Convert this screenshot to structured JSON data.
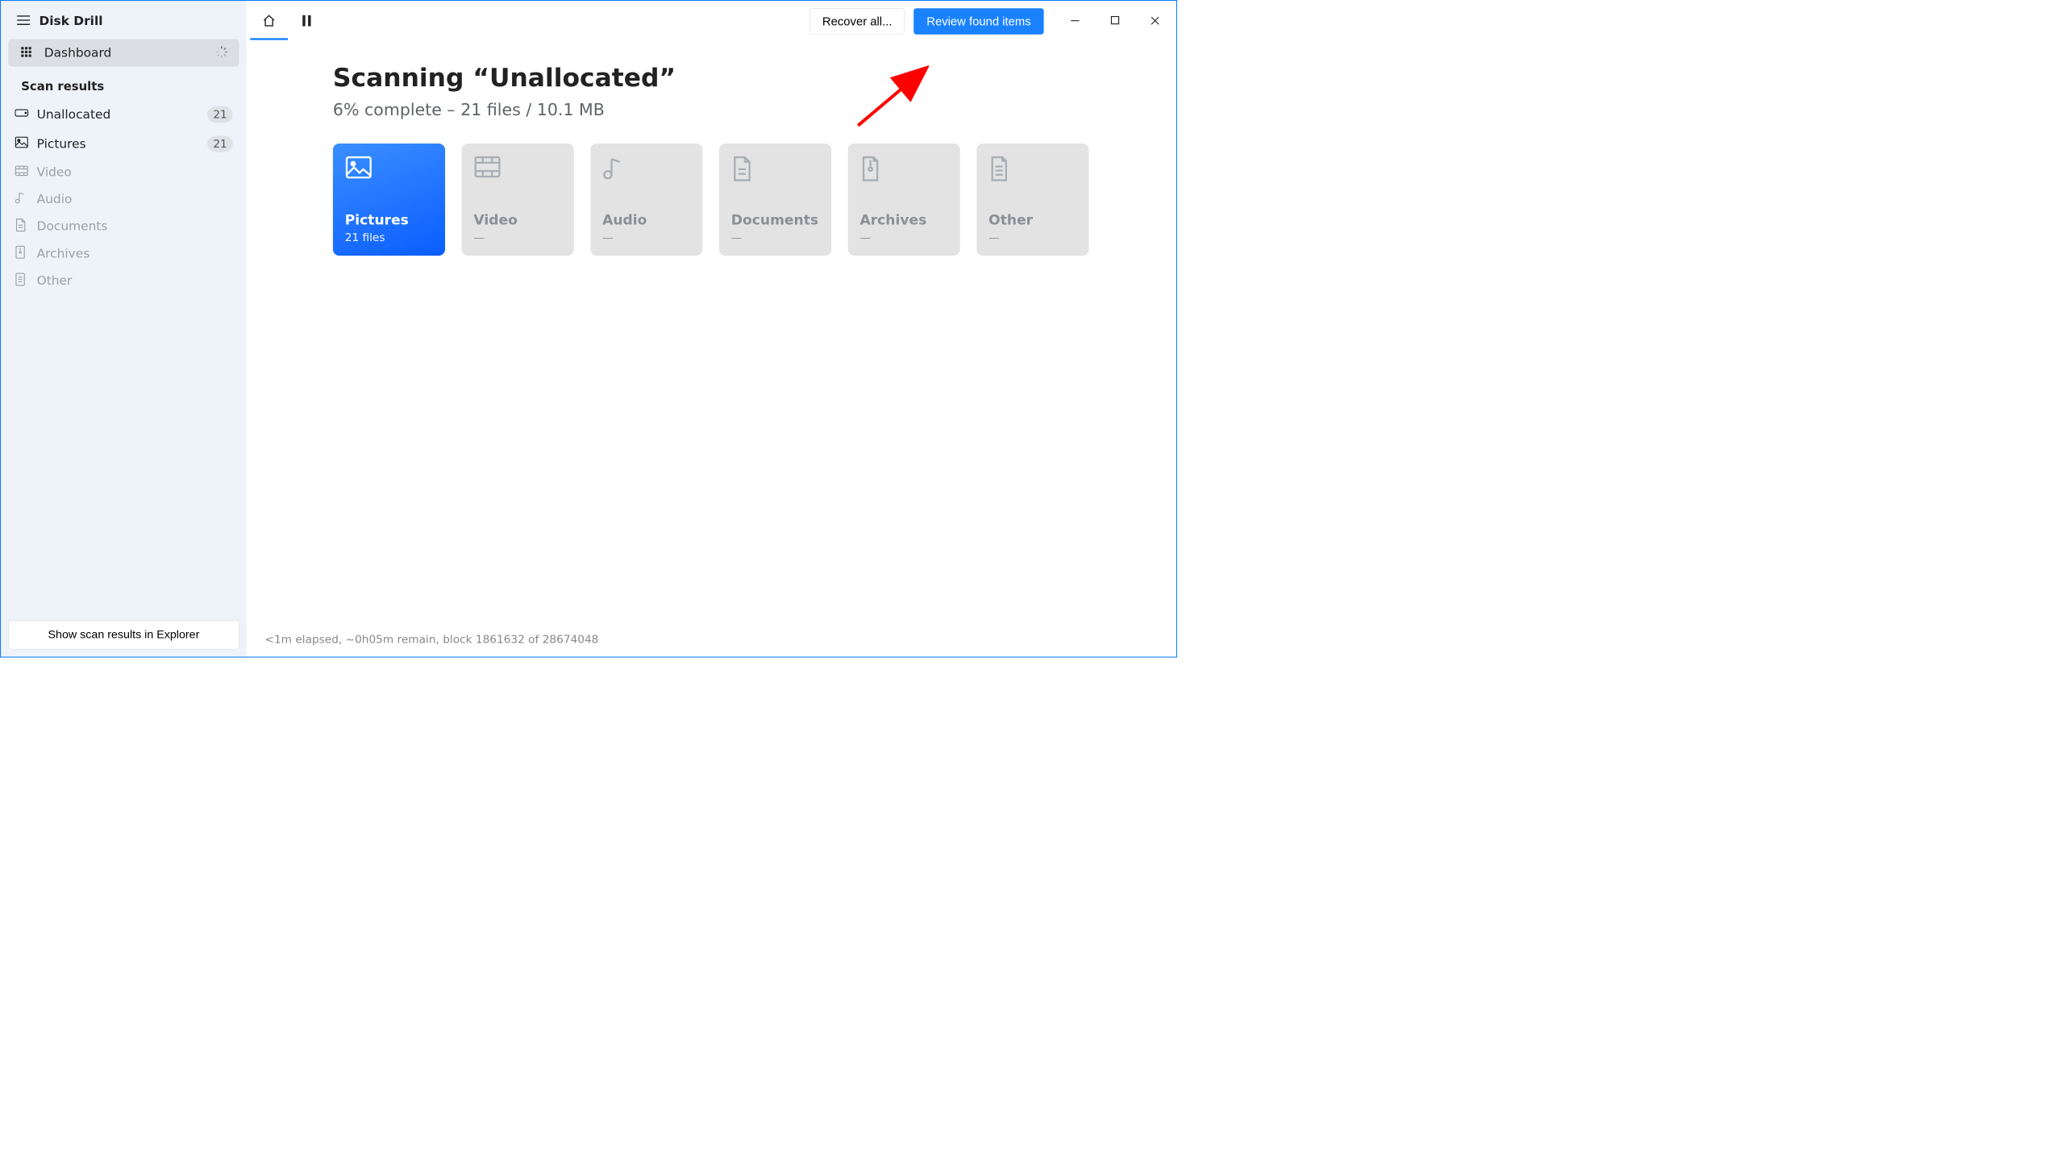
{
  "app": {
    "title": "Disk Drill"
  },
  "sidebar": {
    "dashboard_label": "Dashboard",
    "section_title": "Scan results",
    "items": [
      {
        "label": "Unallocated",
        "count": "21",
        "dim": false
      },
      {
        "label": "Pictures",
        "count": "21",
        "dim": false
      },
      {
        "label": "Video",
        "count": null,
        "dim": true
      },
      {
        "label": "Audio",
        "count": null,
        "dim": true
      },
      {
        "label": "Documents",
        "count": null,
        "dim": true
      },
      {
        "label": "Archives",
        "count": null,
        "dim": true
      },
      {
        "label": "Other",
        "count": null,
        "dim": true
      }
    ],
    "explorer_button": "Show scan results in Explorer"
  },
  "toolbar": {
    "recover_label": "Recover all...",
    "review_label": "Review found items"
  },
  "scan": {
    "title": "Scanning “Unallocated”",
    "subtitle": "6% complete – 21 files / 10.1 MB"
  },
  "cards": [
    {
      "label": "Pictures",
      "sub": "21 files",
      "active": true
    },
    {
      "label": "Video",
      "sub": "—",
      "active": false
    },
    {
      "label": "Audio",
      "sub": "—",
      "active": false
    },
    {
      "label": "Documents",
      "sub": "—",
      "active": false
    },
    {
      "label": "Archives",
      "sub": "—",
      "active": false
    },
    {
      "label": "Other",
      "sub": "—",
      "active": false
    }
  ],
  "status": "<1m elapsed, ~0h05m remain, block 1861632 of 28674048",
  "colors": {
    "accent": "#1a82ff"
  }
}
